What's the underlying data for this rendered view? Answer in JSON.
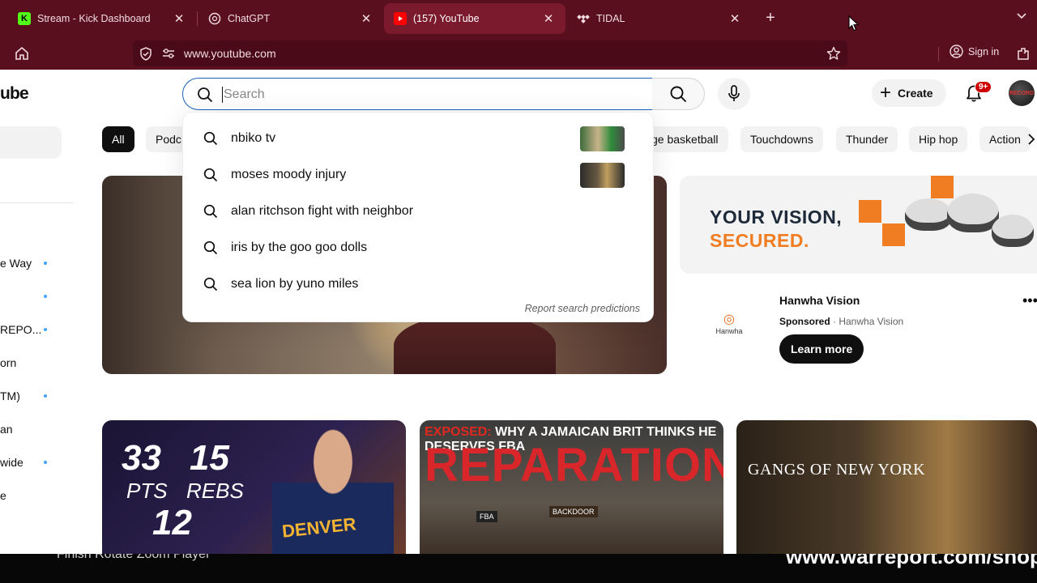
{
  "browser": {
    "tabs": [
      {
        "label": "Stream - Kick Dashboard",
        "icon": "kick-icon"
      },
      {
        "label": "ChatGPT",
        "icon": "chatgpt-icon"
      },
      {
        "label": "(157) YouTube",
        "icon": "youtube-icon",
        "active": true
      },
      {
        "label": "TIDAL",
        "icon": "tidal-icon"
      }
    ],
    "new_tab": "+",
    "url": "www.youtube.com",
    "sign_in": "Sign in"
  },
  "youtube": {
    "logo_fragment": "ube",
    "search": {
      "placeholder": "Search",
      "value": ""
    },
    "create_label": "Create",
    "notif_badge": "9+",
    "avatar_text": "RECORD",
    "sidebar": [
      {
        "label": "",
        "dot": false
      },
      {
        "label": "e Way",
        "dot": true
      },
      {
        "label": "",
        "dot": true
      },
      {
        "label": "REPO...",
        "dot": true
      },
      {
        "label": "orn",
        "dot": false
      },
      {
        "label": "TM)",
        "dot": true
      },
      {
        "label": "an",
        "dot": false
      },
      {
        "label": "wide",
        "dot": true
      },
      {
        "label": "e",
        "dot": false
      }
    ],
    "chips": [
      "All",
      "Podc",
      "ge basketball",
      "Touchdowns",
      "Thunder",
      "Hip hop",
      "Action"
    ],
    "suggestions": [
      {
        "text": "nbiko tv",
        "thumb": true
      },
      {
        "text": "moses moody injury",
        "thumb": true
      },
      {
        "text": "alan ritchson fight with neighbor",
        "thumb": false
      },
      {
        "text": "iris by the goo goo dolls",
        "thumb": false
      },
      {
        "text": "sea lion by yuno miles",
        "thumb": false
      }
    ],
    "report_label": "Report search predictions",
    "ad": {
      "headline_1": "YOUR VISION,",
      "headline_2": "SECURED.",
      "title": "Hanwha Vision",
      "sponsored": "Sponsored",
      "advertiser": "Hanwha Vision",
      "cta": "Learn more",
      "logo_text": "Hanwha",
      "accent": "#f07d22"
    },
    "thumbnails": {
      "t1": {
        "stat1": "33",
        "stat1_label": "PTS",
        "stat2": "15",
        "stat2_label": "REBS",
        "stat3": "12",
        "jersey": "DENVER"
      },
      "t2": {
        "prefix": "EXPOSED:",
        "top": "WHY A JAMAICAN BRIT THINKS HE DESERVES FBA",
        "big": "REPARATIONS",
        "sign1": "FBA",
        "sign2": "BACKDOOR"
      },
      "t3": {
        "title": "GANGS OF NEW YORK"
      }
    }
  },
  "overlay": {
    "left_text": "Finish   Rotate Zoom Player",
    "right_text": "www.warreport.com/shop"
  },
  "colors": {
    "chrome": "#5a0f1e",
    "search_focus": "#1c62b9",
    "badge": "#cc0000"
  }
}
